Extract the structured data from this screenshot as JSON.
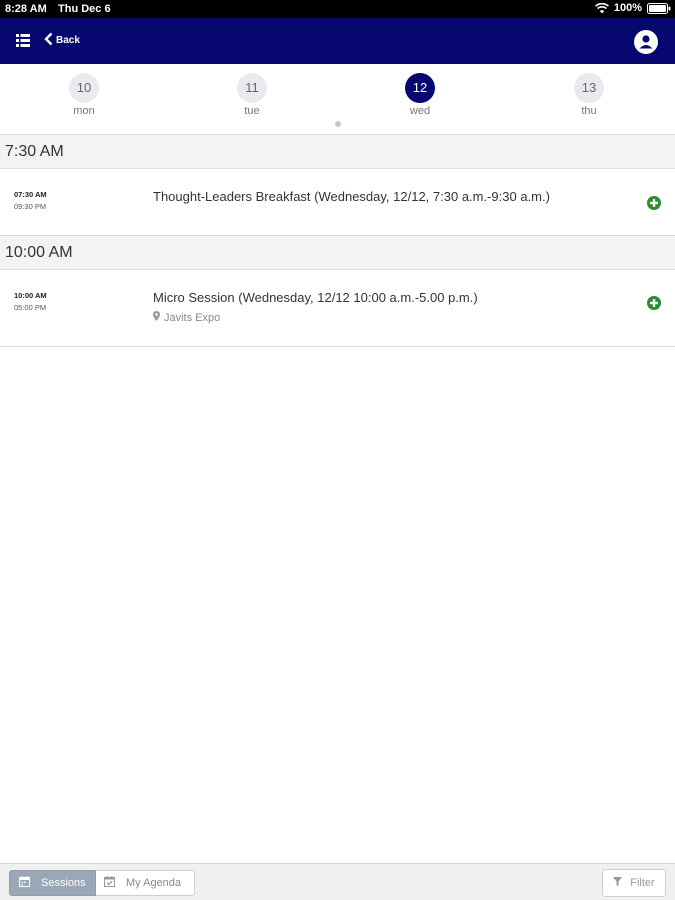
{
  "status_bar": {
    "time": "8:28 AM",
    "date": "Thu Dec 6",
    "battery": "100%"
  },
  "nav": {
    "back_label": "Back"
  },
  "days": [
    {
      "num": "10",
      "weekday": "mon",
      "selected": false
    },
    {
      "num": "11",
      "weekday": "tue",
      "selected": false
    },
    {
      "num": "12",
      "weekday": "wed",
      "selected": true
    },
    {
      "num": "13",
      "weekday": "thu",
      "selected": false
    }
  ],
  "sections": [
    {
      "time": "7:30 AM",
      "sessions": [
        {
          "start": "07:30 AM",
          "end": "09:30 PM",
          "title": "Thought-Leaders Breakfast (Wednesday, 12/12, 7:30 a.m.-9:30 a.m.)",
          "location": ""
        }
      ]
    },
    {
      "time": "10:00 AM",
      "sessions": [
        {
          "start": "10:00 AM",
          "end": "05:00 PM",
          "title": "Micro Session (Wednesday, 12/12 10:00 a.m.-5.00 p.m.)",
          "location": "Javits Expo"
        }
      ]
    }
  ],
  "bottom_bar": {
    "sessions_label": "Sessions",
    "agenda_label": "My Agenda",
    "filter_label": "Filter"
  },
  "colors": {
    "nav": "#07086f",
    "add": "#2e8b2e",
    "selected_tab": "#9aa7b6"
  }
}
